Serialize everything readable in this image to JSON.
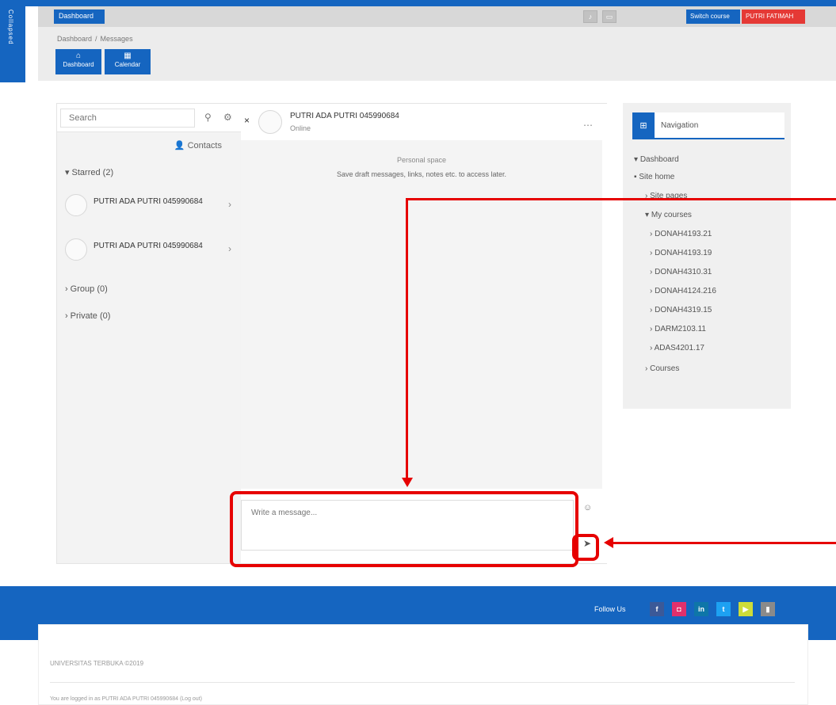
{
  "left_strip": {
    "label": "Collapsed"
  },
  "navbar": {
    "brand": "Dashboard",
    "icons": [
      "bell-icon",
      "chat-icon"
    ],
    "user_button": "Switch course",
    "red_button": "PUTRI FATIMAH"
  },
  "breadcrumb": {
    "home": "Dashboard",
    "current": "Messages"
  },
  "subbar_buttons": [
    {
      "label": "Dashboard",
      "icon": "home-icon"
    },
    {
      "label": "Calendar",
      "icon": "calendar-icon"
    }
  ],
  "messaging": {
    "search_placeholder": "Search",
    "contacts_label": "Contacts",
    "starred_label": "Starred",
    "starred_count": "(2)",
    "conversations": [
      {
        "name": "PUTRI ADA PUTRI 045990684"
      },
      {
        "name": "PUTRI ADA PUTRI 045990684"
      }
    ],
    "group_label": "Group",
    "group_count": "(0)",
    "private_label": "Private",
    "private_count": "(0)"
  },
  "chat": {
    "name": "PUTRI ADA PUTRI 045990684",
    "status": "Online",
    "private_title": "Personal space",
    "private_desc": "Save draft messages, links, notes etc. to access later.",
    "input_placeholder": "Write a message..."
  },
  "navigation_block": {
    "title": "Navigation",
    "items": [
      {
        "label": "Dashboard",
        "level": 0
      },
      {
        "label": "Site home",
        "level": 0
      },
      {
        "label": "Site pages",
        "level": 1
      },
      {
        "label": "My courses",
        "level": 1
      },
      {
        "label": "DONAH4193.21",
        "level": 2
      },
      {
        "label": "DONAH4193.19",
        "level": 2
      },
      {
        "label": "DONAH4310.31",
        "level": 2
      },
      {
        "label": "DONAH4124.216",
        "level": 2
      },
      {
        "label": "DONAH4319.15",
        "level": 2
      },
      {
        "label": "DARM2103.11",
        "level": 2
      },
      {
        "label": "ADAS4201.17",
        "level": 2
      },
      {
        "label": "Courses",
        "level": 1
      }
    ]
  },
  "footer": {
    "follow_label": "Follow Us",
    "social": [
      {
        "icon": "facebook-icon",
        "glyph": "f",
        "color": "#3b5998"
      },
      {
        "icon": "instagram-icon",
        "glyph": "◘",
        "color": "#e1306c"
      },
      {
        "icon": "linkedin-icon",
        "glyph": "in",
        "color": "#0e76a8"
      },
      {
        "icon": "twitter-icon",
        "glyph": "t",
        "color": "#1da1f2"
      },
      {
        "icon": "youtube-icon",
        "glyph": "▶",
        "color": "#cddc39"
      },
      {
        "icon": "mobile-icon",
        "glyph": "▮",
        "color": "#8a8a8a"
      }
    ],
    "text1": "UNIVERSITAS TERBUKA ©2019",
    "text2": "You are logged in as PUTRI ADA PUTRI 045990684 (Log out)"
  },
  "colors": {
    "primary": "#1565c0",
    "danger": "#e53935",
    "annotation": "#e60000"
  }
}
